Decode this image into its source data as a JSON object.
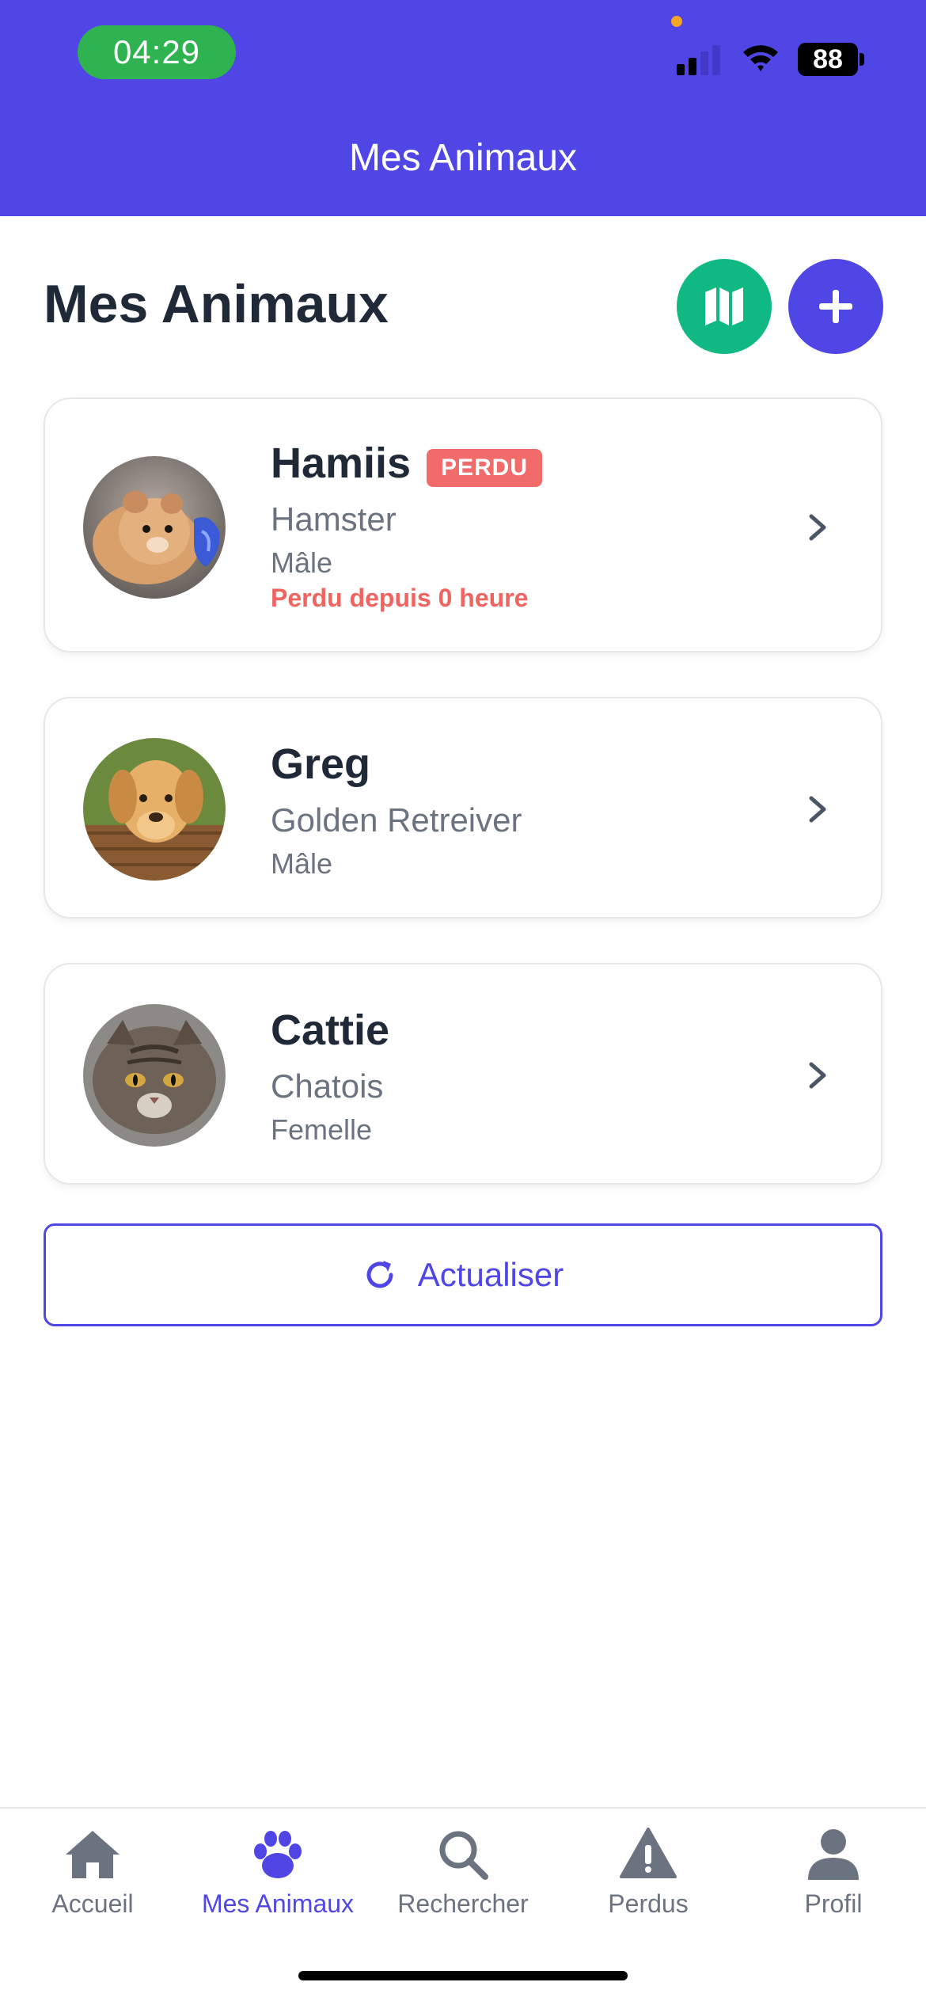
{
  "status_bar": {
    "time": "04:29",
    "battery": "88"
  },
  "nav": {
    "title": "Mes Animaux"
  },
  "main": {
    "title": "Mes Animaux",
    "pets": [
      {
        "name": "Hamiis",
        "badge": "PERDU",
        "breed": "Hamster",
        "sex": "Mâle",
        "lost_since": "Perdu depuis 0 heure"
      },
      {
        "name": "Greg",
        "breed": "Golden Retreiver",
        "sex": "Mâle"
      },
      {
        "name": "Cattie",
        "breed": "Chatois",
        "sex": "Femelle"
      }
    ],
    "refresh_label": "Actualiser"
  },
  "tabbar": {
    "tabs": [
      {
        "label": "Accueil",
        "icon": "home-icon"
      },
      {
        "label": "Mes Animaux",
        "icon": "paw-icon",
        "active": true
      },
      {
        "label": "Rechercher",
        "icon": "search-icon"
      },
      {
        "label": "Perdus",
        "icon": "warning-icon"
      },
      {
        "label": "Profil",
        "icon": "user-icon"
      }
    ]
  },
  "colors": {
    "primary": "#4f46e5",
    "map_button": "#10b981",
    "lost": "#f26b6b",
    "status_pill": "#2fb350"
  }
}
